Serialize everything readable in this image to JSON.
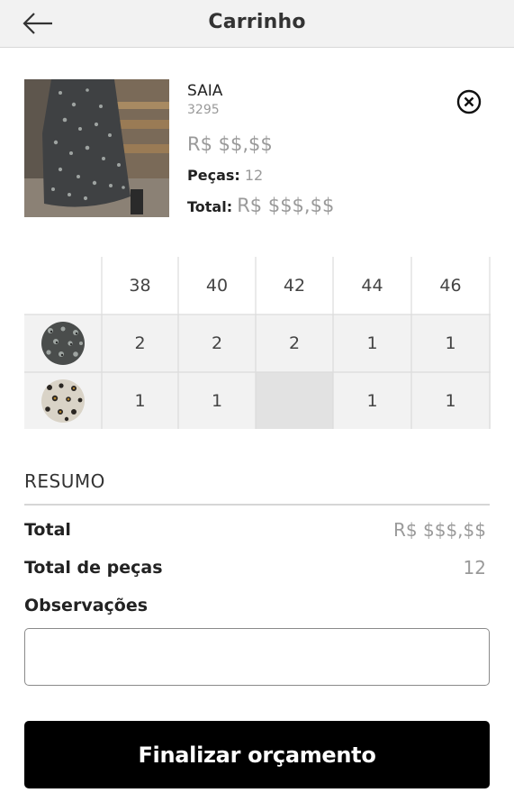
{
  "header": {
    "title": "Carrinho",
    "back_icon": "arrow-left-icon"
  },
  "product": {
    "name": "SAIA",
    "code": "3295",
    "price": "R$ $$,$$",
    "pieces_label": "Peças:",
    "pieces_value": "12",
    "total_label": "Total:",
    "total_value": "R$ $$$,$$",
    "remove_icon": "close-circle-icon"
  },
  "grid": {
    "sizes": [
      "38",
      "40",
      "42",
      "44",
      "46"
    ],
    "rows": [
      {
        "swatch": "dark-leopard-print",
        "quantities": [
          "2",
          "2",
          "2",
          "1",
          "1"
        ]
      },
      {
        "swatch": "light-leopard-print",
        "quantities": [
          "1",
          "1",
          "",
          "1",
          "1"
        ]
      }
    ]
  },
  "summary": {
    "title": "RESUMO",
    "total_label": "Total",
    "total_value": "R$ $$$,$$",
    "pieces_label": "Total de peças",
    "pieces_value": "12",
    "notes_label": "Observações",
    "notes_value": ""
  },
  "actions": {
    "submit_label": "Finalizar orçamento"
  },
  "colors": {
    "header_bg": "#f2f2f2",
    "button_bg": "#000000",
    "muted_text": "#9a9a9a",
    "cell_bg": "#f2f2f2"
  }
}
